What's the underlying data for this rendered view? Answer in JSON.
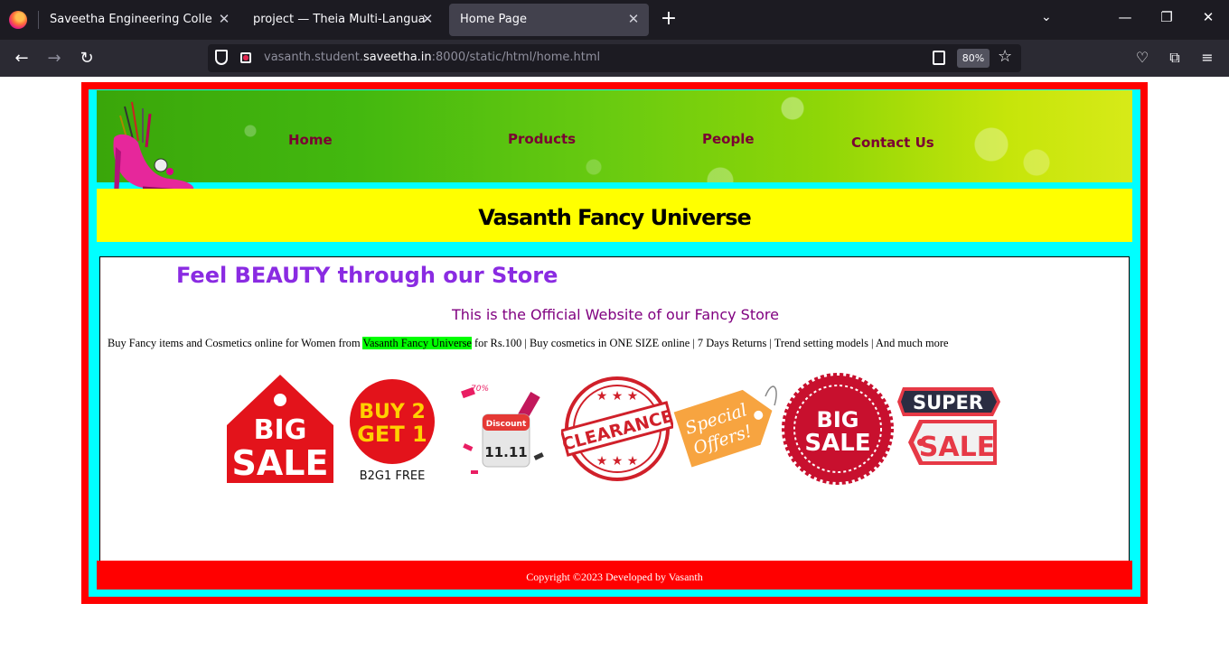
{
  "browser": {
    "tabs": [
      {
        "title": "Saveetha Engineering College"
      },
      {
        "title": "project — Theia Multi-Language Exp"
      },
      {
        "title": "Home Page"
      }
    ],
    "url": {
      "prefix": "vasanth.student.",
      "host": "saveetha.in",
      "suffix": ":8000/static/html/home.html"
    },
    "zoom": "80%"
  },
  "site": {
    "nav": [
      "Home",
      "Products",
      "People",
      "Contact Us"
    ],
    "title": "Vasanth Fancy Universe",
    "tagline": "Feel BEAUTY through our Store",
    "official": "This is the Official Website of our Fancy Store",
    "desc_before": "Buy Fancy items and Cosmetics online for Women from ",
    "desc_highlight": "Vasanth Fancy Universe",
    "desc_after": " for Rs.100 | Buy cosmetics in ONE SIZE online | 7 Days Returns | Trend setting models | And much more",
    "badges": {
      "big_sale_1": "BIG",
      "big_sale_2": "SALE",
      "buy2_1": "BUY 2",
      "buy2_2": "GET 1",
      "buy2_caption": "B2G1 FREE",
      "discount_label": "Discount",
      "discount_date": "11.11",
      "discount_pct": "70%",
      "clearance": "CLEARANCE",
      "special_1": "Special",
      "special_2": "Offers!",
      "seal_1": "BIG",
      "seal_2": "SALE",
      "super_1": "SUPER",
      "super_2": "SALE"
    },
    "footer": "Copyright ©2023 Developed by Vasanth"
  },
  "colors": {
    "frame": "#ff0000",
    "inner_frame": "#00ffff",
    "title_bg": "#ffff00",
    "nav_text": "#7a0033",
    "tagline": "#8a2be2",
    "official": "#800080",
    "highlight": "#00ff00"
  }
}
